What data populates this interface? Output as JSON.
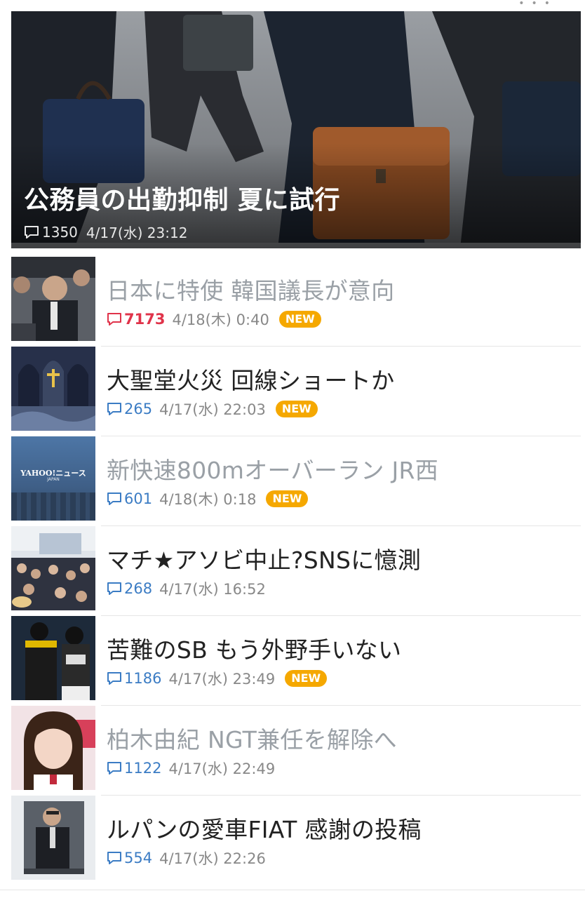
{
  "hero": {
    "title": "公務員の出勤抑制 夏に試行",
    "comments": "1350",
    "date": "4/17(水) 23:12"
  },
  "articles": [
    {
      "title": "日本に特使 韓国議長が意向",
      "comments": "7173",
      "date": "4/18(木) 0:40",
      "badge": "NEW",
      "hot": true,
      "read": true,
      "thumb": "press-conference-photo"
    },
    {
      "title": "大聖堂火災 回線ショートか",
      "comments": "265",
      "date": "4/17(水) 22:03",
      "badge": "NEW",
      "hot": false,
      "read": false,
      "thumb": "cathedral-interior-photo"
    },
    {
      "title": "新快速800mオーバーラン JR西",
      "comments": "601",
      "date": "4/18(木) 0:18",
      "badge": "NEW",
      "hot": false,
      "read": true,
      "thumb": "yahoo-news-logo-image",
      "thumb_text": "YAHOO!ニュース",
      "thumb_subtext": "JAPAN"
    },
    {
      "title": "マチ★アソビ中止?SNSに憶測",
      "comments": "268",
      "date": "4/17(水) 16:52",
      "badge": "",
      "hot": false,
      "read": false,
      "thumb": "outdoor-event-crowd-photo"
    },
    {
      "title": "苦難のSB もう外野手いない",
      "comments": "1186",
      "date": "4/17(水) 23:49",
      "badge": "NEW",
      "hot": false,
      "read": false,
      "thumb": "baseball-players-photo"
    },
    {
      "title": "柏木由紀 NGT兼任を解除へ",
      "comments": "1122",
      "date": "4/17(水) 22:49",
      "badge": "",
      "hot": false,
      "read": true,
      "thumb": "idol-portrait-photo"
    },
    {
      "title": "ルパンの愛車FIAT 感謝の投稿",
      "comments": "554",
      "date": "4/17(水) 22:26",
      "badge": "",
      "hot": false,
      "read": false,
      "thumb": "man-at-podium-photo"
    }
  ],
  "colors": {
    "comment_blue": "#3b7cc4",
    "comment_hot": "#e0334a",
    "badge_bg": "#f5a800",
    "read_title": "#9aa0a6",
    "unread_title": "#222222"
  }
}
